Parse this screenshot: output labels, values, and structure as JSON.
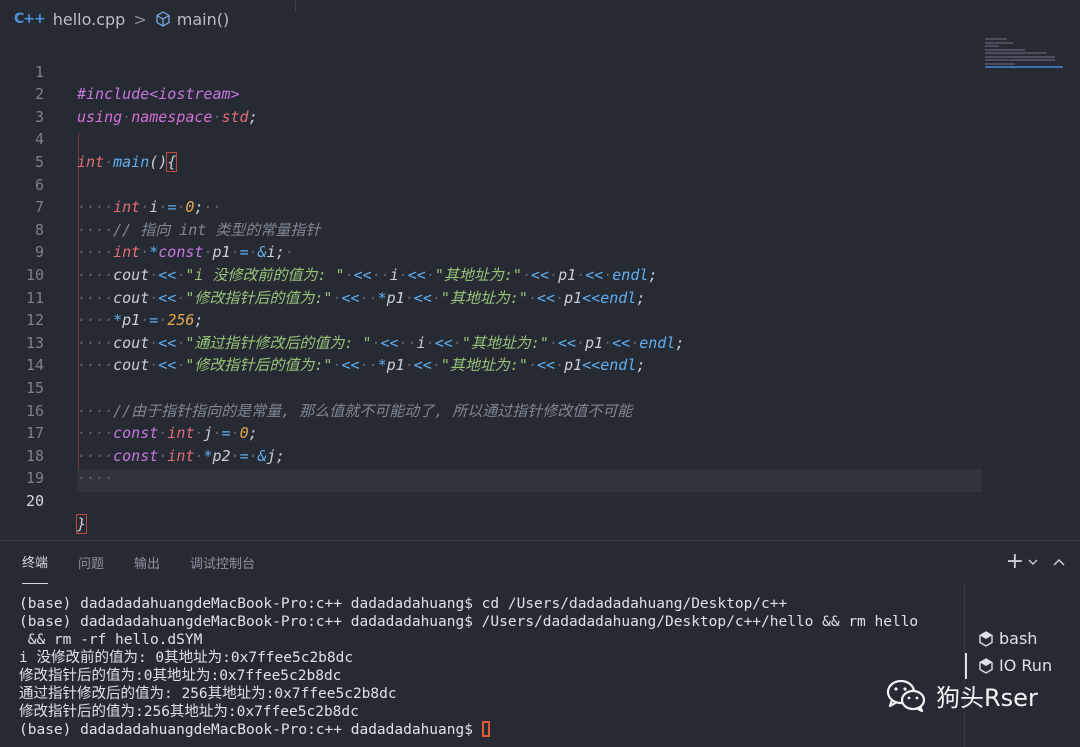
{
  "breadcrumb": {
    "file_icon": "C++",
    "file": "hello.cpp",
    "separator": ">",
    "symbol": "main()"
  },
  "editor": {
    "line_numbers": [
      "1",
      "2",
      "3",
      "4",
      "5",
      "6",
      "7",
      "8",
      "9",
      "10",
      "11",
      "12",
      "13",
      "14",
      "15",
      "16",
      "17",
      "18",
      "19",
      "20"
    ],
    "active_line": "20"
  },
  "code_text": {
    "l1a": "#include",
    "l1b": "<iostream>",
    "l2a": "using",
    "l2b": "namespace",
    "l2c": "std",
    "l2d": ";",
    "l4a": "int",
    "l4b": "main",
    "l4c": "()",
    "l4d": "{",
    "l6a": "int",
    "l6b": "i",
    "l6c": "=",
    "l6d": "0",
    "l6e": ";",
    "l7": "// 指向 int 类型的常量指针",
    "l8a": "int",
    "l8b": "*",
    "l8c": "const",
    "l8d": "p1",
    "l8e": "=",
    "l8f": "&",
    "l8g": "i",
    "l8h": ";",
    "l9a": "cout",
    "l9b": "<<",
    "l9c": "\"i 没修改前的值为: \"",
    "l9d": "<<",
    "l9e": "i",
    "l9f": "<<",
    "l9g": "\"其地址为:\"",
    "l9h": "<<",
    "l9i": "p1",
    "l9j": "<<",
    "l9k": "endl",
    "l9l": ";",
    "l10a": "cout",
    "l10b": "<<",
    "l10c": "\"修改指针后的值为:\"",
    "l10d": "<<",
    "l10e": "*",
    "l10f": "p1",
    "l10g": "<<",
    "l10h": "\"其地址为:\"",
    "l10i": "<<",
    "l10j": "p1",
    "l10k": "<<",
    "l10l": "endl",
    "l10m": ";",
    "l11a": "*",
    "l11b": "p1",
    "l11c": "=",
    "l11d": "256",
    "l11e": ";",
    "l12a": "cout",
    "l12b": "<<",
    "l12c": "\"通过指针修改后的值为: \"",
    "l12d": "<<",
    "l12e": "i",
    "l12f": "<<",
    "l12g": "\"其地址为:\"",
    "l12h": "<<",
    "l12i": "p1",
    "l12j": "<<",
    "l12k": "endl",
    "l12l": ";",
    "l13a": "cout",
    "l13b": "<<",
    "l13c": "\"修改指针后的值为:\"",
    "l13d": "<<",
    "l13e": "*",
    "l13f": "p1",
    "l13g": "<<",
    "l13h": "\"其地址为:\"",
    "l13i": "<<",
    "l13j": "p1",
    "l13k": "<<",
    "l13l": "endl",
    "l13m": ";",
    "l15": "//由于指针指向的是常量, 那么值就不可能动了, 所以通过指针修改值不可能",
    "l16a": "const",
    "l16b": "int",
    "l16c": "j",
    "l16d": "=",
    "l16e": "0",
    "l16f": ";",
    "l17a": "const",
    "l17b": "int",
    "l17c": "*",
    "l17d": "p2",
    "l17e": "=",
    "l17f": "&",
    "l17g": "j",
    "l17h": ";",
    "l18": "····",
    "l20": "}"
  },
  "panel": {
    "tabs": [
      "终端",
      "问题",
      "输出",
      "调试控制台"
    ],
    "add_label": "+",
    "terminal_lines": [
      "(base) dadadadahuangdeMacBook-Pro:c++ dadadadahuang$ cd /Users/dadadadahuang/Desktop/c++",
      "(base) dadadadahuangdeMacBook-Pro:c++ dadadadahuang$ /Users/dadadadahuang/Desktop/c++/hello && rm hello",
      " && rm -rf hello.dSYM",
      "i 没修改前的值为: 0其地址为:0x7ffee5c2b8dc",
      "修改指针后的值为:0其地址为:0x7ffee5c2b8dc",
      "通过指针修改后的值为: 256其地址为:0x7ffee5c2b8dc",
      "修改指针后的值为:256其地址为:0x7ffee5c2b8dc",
      "(base) dadadadahuangdeMacBook-Pro:c++ dadadadahuang$ "
    ],
    "terminals": [
      "bash",
      "IO Run"
    ],
    "active_terminal": "IO Run"
  },
  "watermark": {
    "text": "狗头Rser"
  }
}
